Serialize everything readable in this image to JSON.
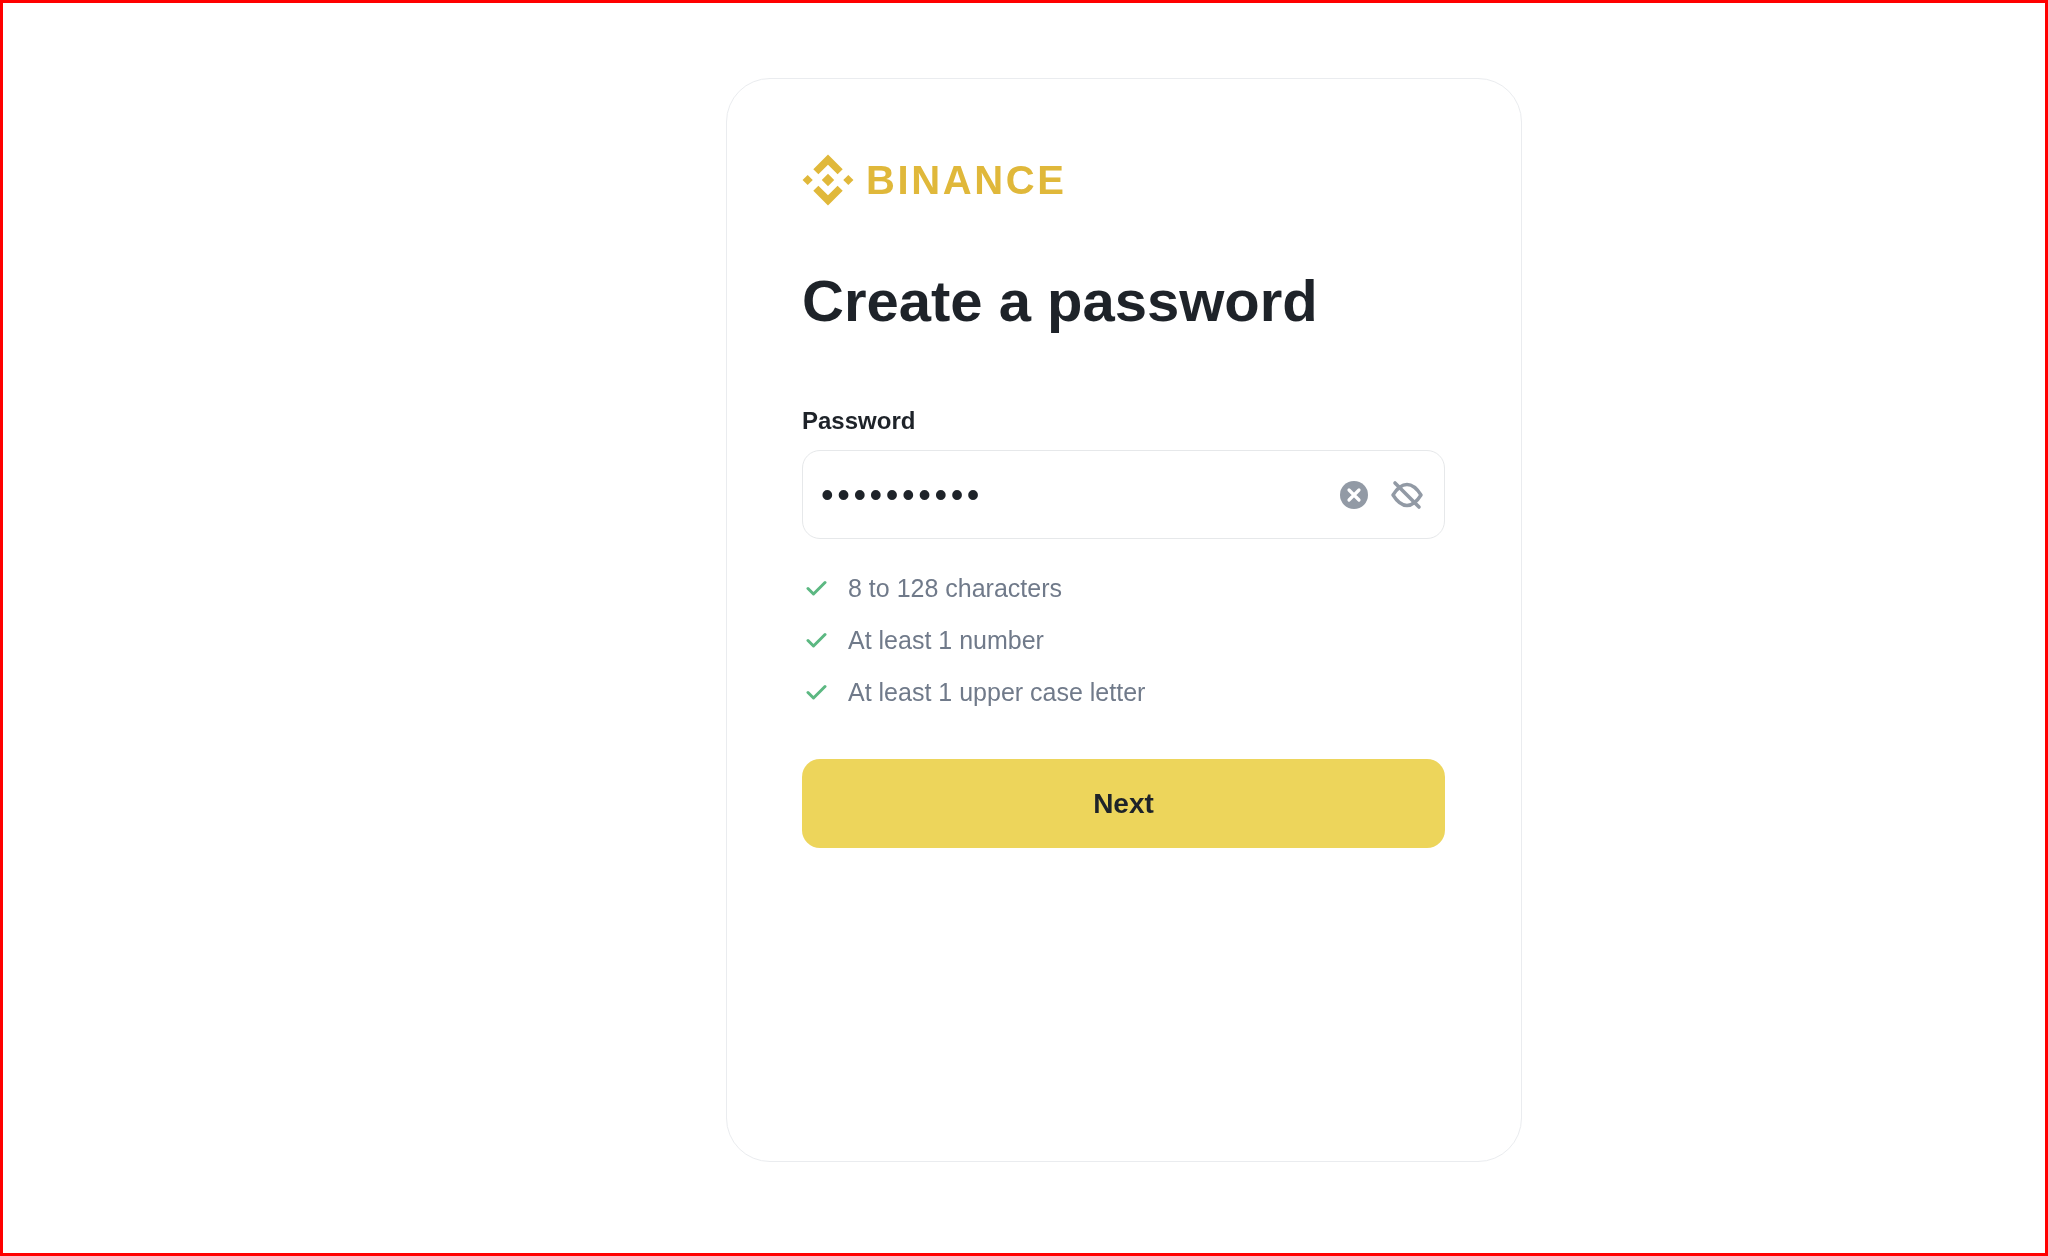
{
  "logo": {
    "text": "BINANCE"
  },
  "title": "Create a password",
  "password_field": {
    "label": "Password",
    "value": "••••••••••",
    "masked": true
  },
  "requirements": [
    {
      "text": "8 to 128 characters",
      "met": true
    },
    {
      "text": "At least 1 number",
      "met": true
    },
    {
      "text": "At least 1 upper case letter",
      "met": true
    }
  ],
  "next_button": {
    "label": "Next"
  }
}
